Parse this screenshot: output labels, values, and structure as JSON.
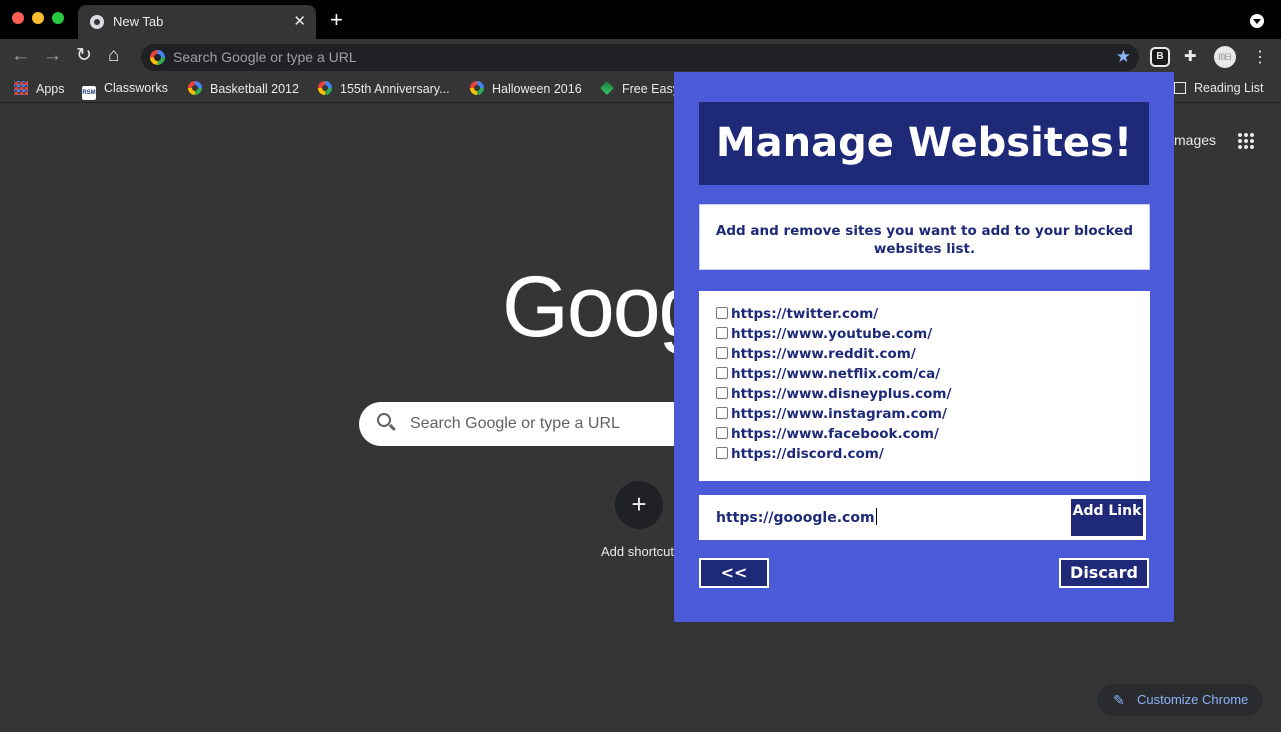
{
  "browser": {
    "tab_title": "New Tab",
    "tab_close": "✕",
    "new_tab": "+",
    "omnibox_placeholder": "Search Google or type a URL",
    "avatar_text": "ᗰᗷ",
    "bookmarks": [
      {
        "label": "Apps",
        "icon": "apps-grid-icon"
      },
      {
        "label": "Classworks",
        "icon": "rsm-icon"
      },
      {
        "label": "Basketball 2012",
        "icon": "google-icon"
      },
      {
        "label": "155th Anniversary...",
        "icon": "google-icon"
      },
      {
        "label": "Halloween 2016",
        "icon": "google-icon"
      },
      {
        "label": "Free Easy",
        "icon": "leaf-icon"
      }
    ],
    "reading_list": "Reading List"
  },
  "ntp": {
    "images_link": "mages",
    "logo": "Goog",
    "search_placeholder": "Search Google or type a URL",
    "add_shortcut_label": "Add shortcut",
    "customize_label": "Customize Chrome"
  },
  "popup": {
    "title": "Manage Websites!",
    "description": "Add and remove sites you want to add to your blocked websites list.",
    "sites": [
      {
        "url": "https://twitter.com/",
        "checked": false
      },
      {
        "url": "https://www.youtube.com/",
        "checked": false
      },
      {
        "url": "https://www.reddit.com/",
        "checked": false
      },
      {
        "url": "https://www.netflix.com/ca/",
        "checked": false
      },
      {
        "url": "https://www.disneyplus.com/",
        "checked": false
      },
      {
        "url": "https://www.instagram.com/",
        "checked": false
      },
      {
        "url": "https://www.facebook.com/",
        "checked": false
      },
      {
        "url": "https://discord.com/",
        "checked": false
      }
    ],
    "input_value": "https://gooogle.com",
    "add_button": "Add Link",
    "back_button": "<<",
    "discard_button": "Discard"
  },
  "colors": {
    "popup_bg": "#4b5bd7",
    "popup_dark": "#1e2a78",
    "browser_bg": "#353535"
  }
}
